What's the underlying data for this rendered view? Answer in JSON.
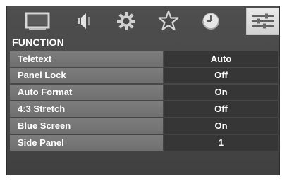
{
  "menu_title": "FUNCTION",
  "tabs": [
    {
      "icon": "picture-icon",
      "active": false
    },
    {
      "icon": "speaker-icon",
      "active": false
    },
    {
      "icon": "gear-icon",
      "active": false
    },
    {
      "icon": "star-icon",
      "active": false
    },
    {
      "icon": "clock-icon",
      "active": false
    },
    {
      "icon": "sliders-icon",
      "active": true
    }
  ],
  "rows": [
    {
      "label": "Teletext",
      "value": "Auto"
    },
    {
      "label": "Panel Lock",
      "value": "Off"
    },
    {
      "label": "Auto Format",
      "value": "On"
    },
    {
      "label": "4:3 Stretch",
      "value": "Off"
    },
    {
      "label": "Blue Screen",
      "value": "On"
    },
    {
      "label": "Side Panel",
      "value": "1"
    }
  ],
  "colors": {
    "panel_bg": "#474747",
    "label_bg": "#777777",
    "value_bg": "#363636",
    "active_tab_bg": "#dddddd",
    "text": "#ffffff"
  }
}
